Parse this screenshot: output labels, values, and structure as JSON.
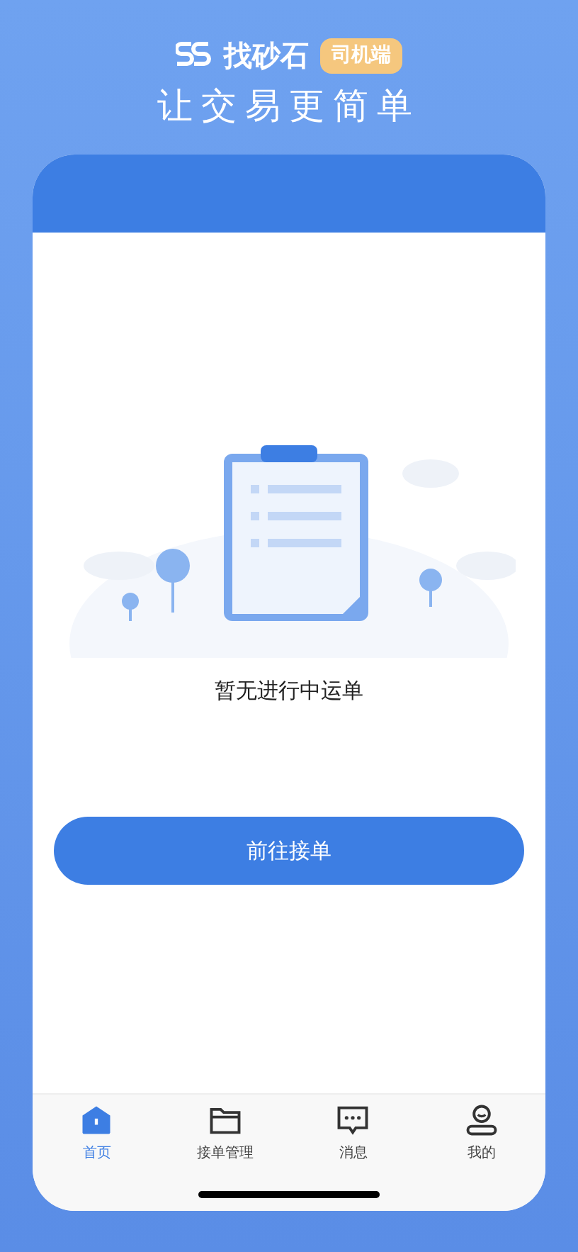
{
  "header": {
    "brand": "找砂石",
    "badge": "司机端",
    "slogan": "让交易更简单"
  },
  "empty_state": {
    "message": "暂无进行中运单"
  },
  "action_button": {
    "label": "前往接单"
  },
  "tabs": [
    {
      "kind": "home",
      "label": "首页",
      "selected": true
    },
    {
      "kind": "folder",
      "label": "接单管理",
      "selected": false
    },
    {
      "kind": "message",
      "label": "消息",
      "selected": false
    },
    {
      "kind": "profile",
      "label": "我的",
      "selected": false
    }
  ]
}
